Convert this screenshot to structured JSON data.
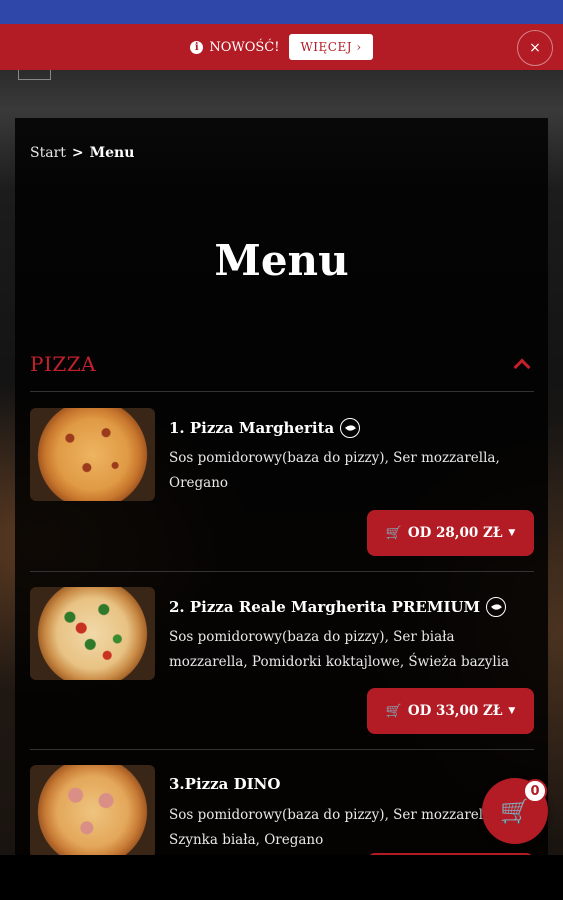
{
  "notice": {
    "icon": "info-icon",
    "text": "NOWOŚĆ!",
    "more_label": "WIĘCEJ ›",
    "close_label": "×"
  },
  "breadcrumb": {
    "start": "Start",
    "separator": ">",
    "current": "Menu"
  },
  "page": {
    "title": "Menu"
  },
  "category": {
    "title": "PIZZA",
    "icon": "chevron-up-icon"
  },
  "items": [
    {
      "name": "1. Pizza Margherita",
      "vegetarian_icon": "leaf-icon",
      "description": "Sos pomidorowy(baza do pizzy), Ser mozzarella, Oregano",
      "price_label": "OD 28,00 ZŁ"
    },
    {
      "name": "2. Pizza Reale Margherita PREMIUM",
      "vegetarian_icon": "leaf-icon",
      "description": "Sos pomidorowy(baza do pizzy), Ser biała mozzarella, Pomidorki koktajlowe, Świeża bazylia",
      "price_label": "OD 33,00 ZŁ"
    },
    {
      "name": "3.Pizza DINO",
      "description": "Sos pomidorowy(baza do pizzy), Ser mozzarella, Szynka biała, Oregano"
    }
  ],
  "cart": {
    "count": "0",
    "icon": "cart-icon"
  },
  "colors": {
    "accent": "#b41c25",
    "status_bar": "#2f47a8"
  }
}
